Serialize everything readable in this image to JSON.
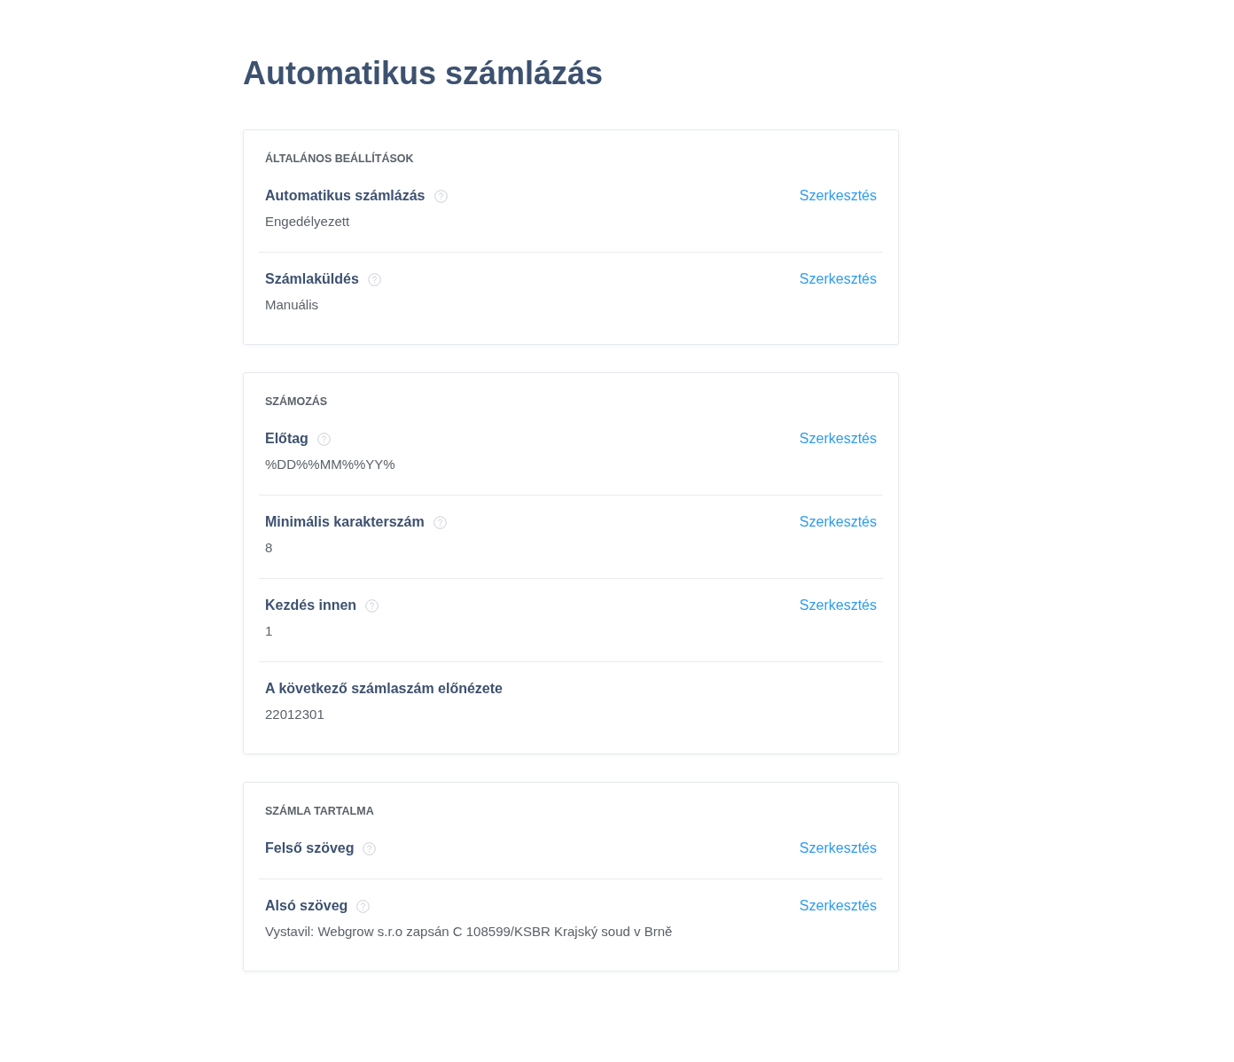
{
  "page_title": "Automatikus számlázás",
  "sections": [
    {
      "title": "ÁLTALÁNOS BEÁLLÍTÁSOK",
      "rows": [
        {
          "label": "Automatikus számlázás",
          "help": true,
          "value": "Engedélyezett",
          "action": "Szerkesztés"
        },
        {
          "label": "Számlaküldés",
          "help": true,
          "value": "Manuális",
          "action": "Szerkesztés"
        }
      ]
    },
    {
      "title": "SZÁMOZÁS",
      "rows": [
        {
          "label": "Előtag",
          "help": true,
          "value": "%DD%%MM%%YY%",
          "action": "Szerkesztés"
        },
        {
          "label": "Minimális karakterszám",
          "help": true,
          "value": "8",
          "action": "Szerkesztés"
        },
        {
          "label": "Kezdés innen",
          "help": true,
          "value": "1",
          "action": "Szerkesztés"
        },
        {
          "label": "A következő számlaszám előnézete",
          "help": false,
          "value": "22012301"
        }
      ]
    },
    {
      "title": "SZÁMLA TARTALMA",
      "rows": [
        {
          "label": "Felső szöveg",
          "help": true,
          "action": "Szerkesztés"
        },
        {
          "label": "Alsó szöveg",
          "help": true,
          "value": "Vystavil: Webgrow s.r.o zapsán C 108599/KSBR Krajský soud v Brně",
          "action": "Szerkesztés"
        }
      ]
    }
  ]
}
